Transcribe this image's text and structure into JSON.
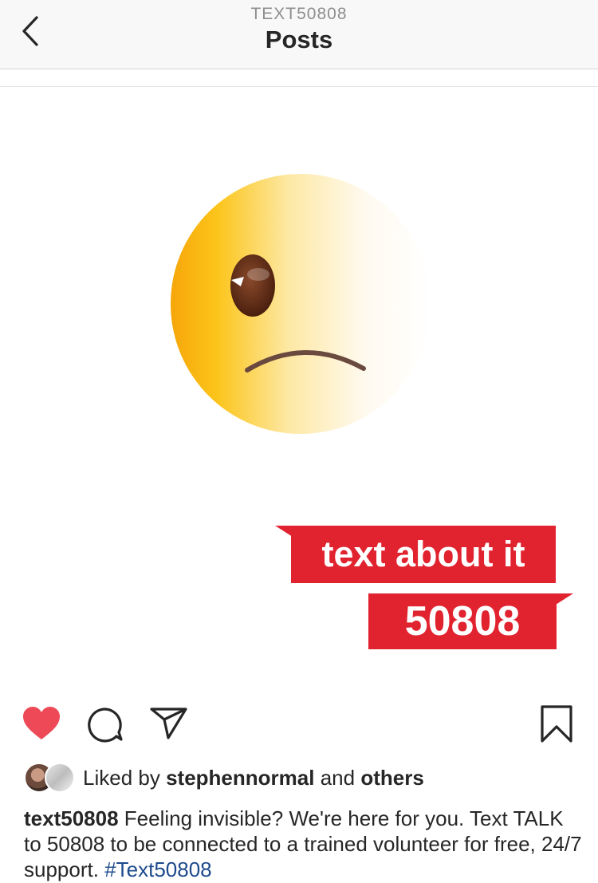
{
  "header": {
    "subtitle": "TEXT50808",
    "title": "Posts"
  },
  "post": {
    "image": {
      "banner_line_1": "text about it",
      "banner_line_2": "50808",
      "emoji": "slightly-frowning-emoji",
      "banner_color": "#e1232f"
    },
    "actions": {
      "like_icon": "heart-icon",
      "comment_icon": "comment-icon",
      "share_icon": "send-icon",
      "save_icon": "bookmark-icon",
      "liked_color": "#ed4956"
    },
    "likes": {
      "prefix": "Liked by",
      "user": "stephennormal",
      "conjunction": "and",
      "others": "others"
    },
    "caption": {
      "username": "text50808",
      "text": "Feeling invisible? We're here for you. Text TALK to 50808 to be connected to a trained volunteer for free, 24/7 support.",
      "hashtag": "#Text50808"
    }
  }
}
